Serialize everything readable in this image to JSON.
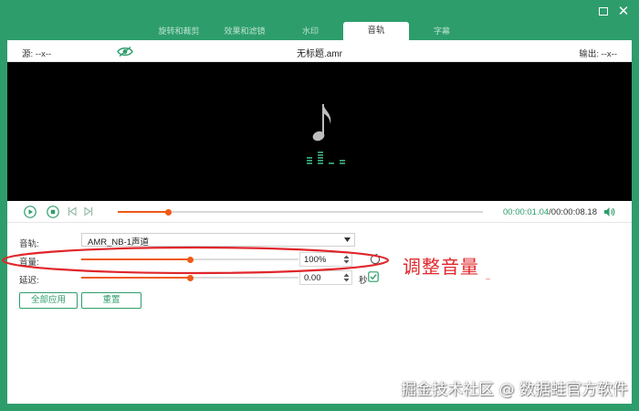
{
  "window": {
    "maximize_icon": "maximize-icon",
    "close_icon": "close-icon",
    "close_glyph": "✕"
  },
  "tabs": [
    {
      "label": "旋转和裁剪",
      "active": false
    },
    {
      "label": "效果和滤镜",
      "active": false
    },
    {
      "label": "水印",
      "active": false
    },
    {
      "label": "音轨",
      "active": true
    },
    {
      "label": "字幕",
      "active": false
    }
  ],
  "infobar": {
    "source_label": "源: --x--",
    "eye_icon": "eye-icon",
    "file_title": "无标题.amr",
    "output_label": "输出: --x--"
  },
  "preview": {
    "note_icon": "music-note-icon",
    "eq_icon": "equalizer-icon"
  },
  "playback": {
    "progress_fraction": 0.138,
    "current_time": "00:00:01.04",
    "total_time": "/00:00:08.18"
  },
  "settings": {
    "track_label": "音轨:",
    "track_value": "AMR_NB-1声道",
    "volume_label": "音量:",
    "volume_value": "100%",
    "volume_fraction": 0.5,
    "delay_label": "延迟:",
    "delay_value": "0.00",
    "delay_fraction": 0.5,
    "delay_unit": "秒",
    "apply_all_label": "全部应用",
    "reset_label": "重置"
  },
  "annotation": {
    "text": "调整音量",
    "color": "#e0262b"
  },
  "watermark": "掘金技术社区 @ 数据蛙官方软件",
  "colors": {
    "accent": "#2e9d6c",
    "progress": "#f05a16"
  }
}
